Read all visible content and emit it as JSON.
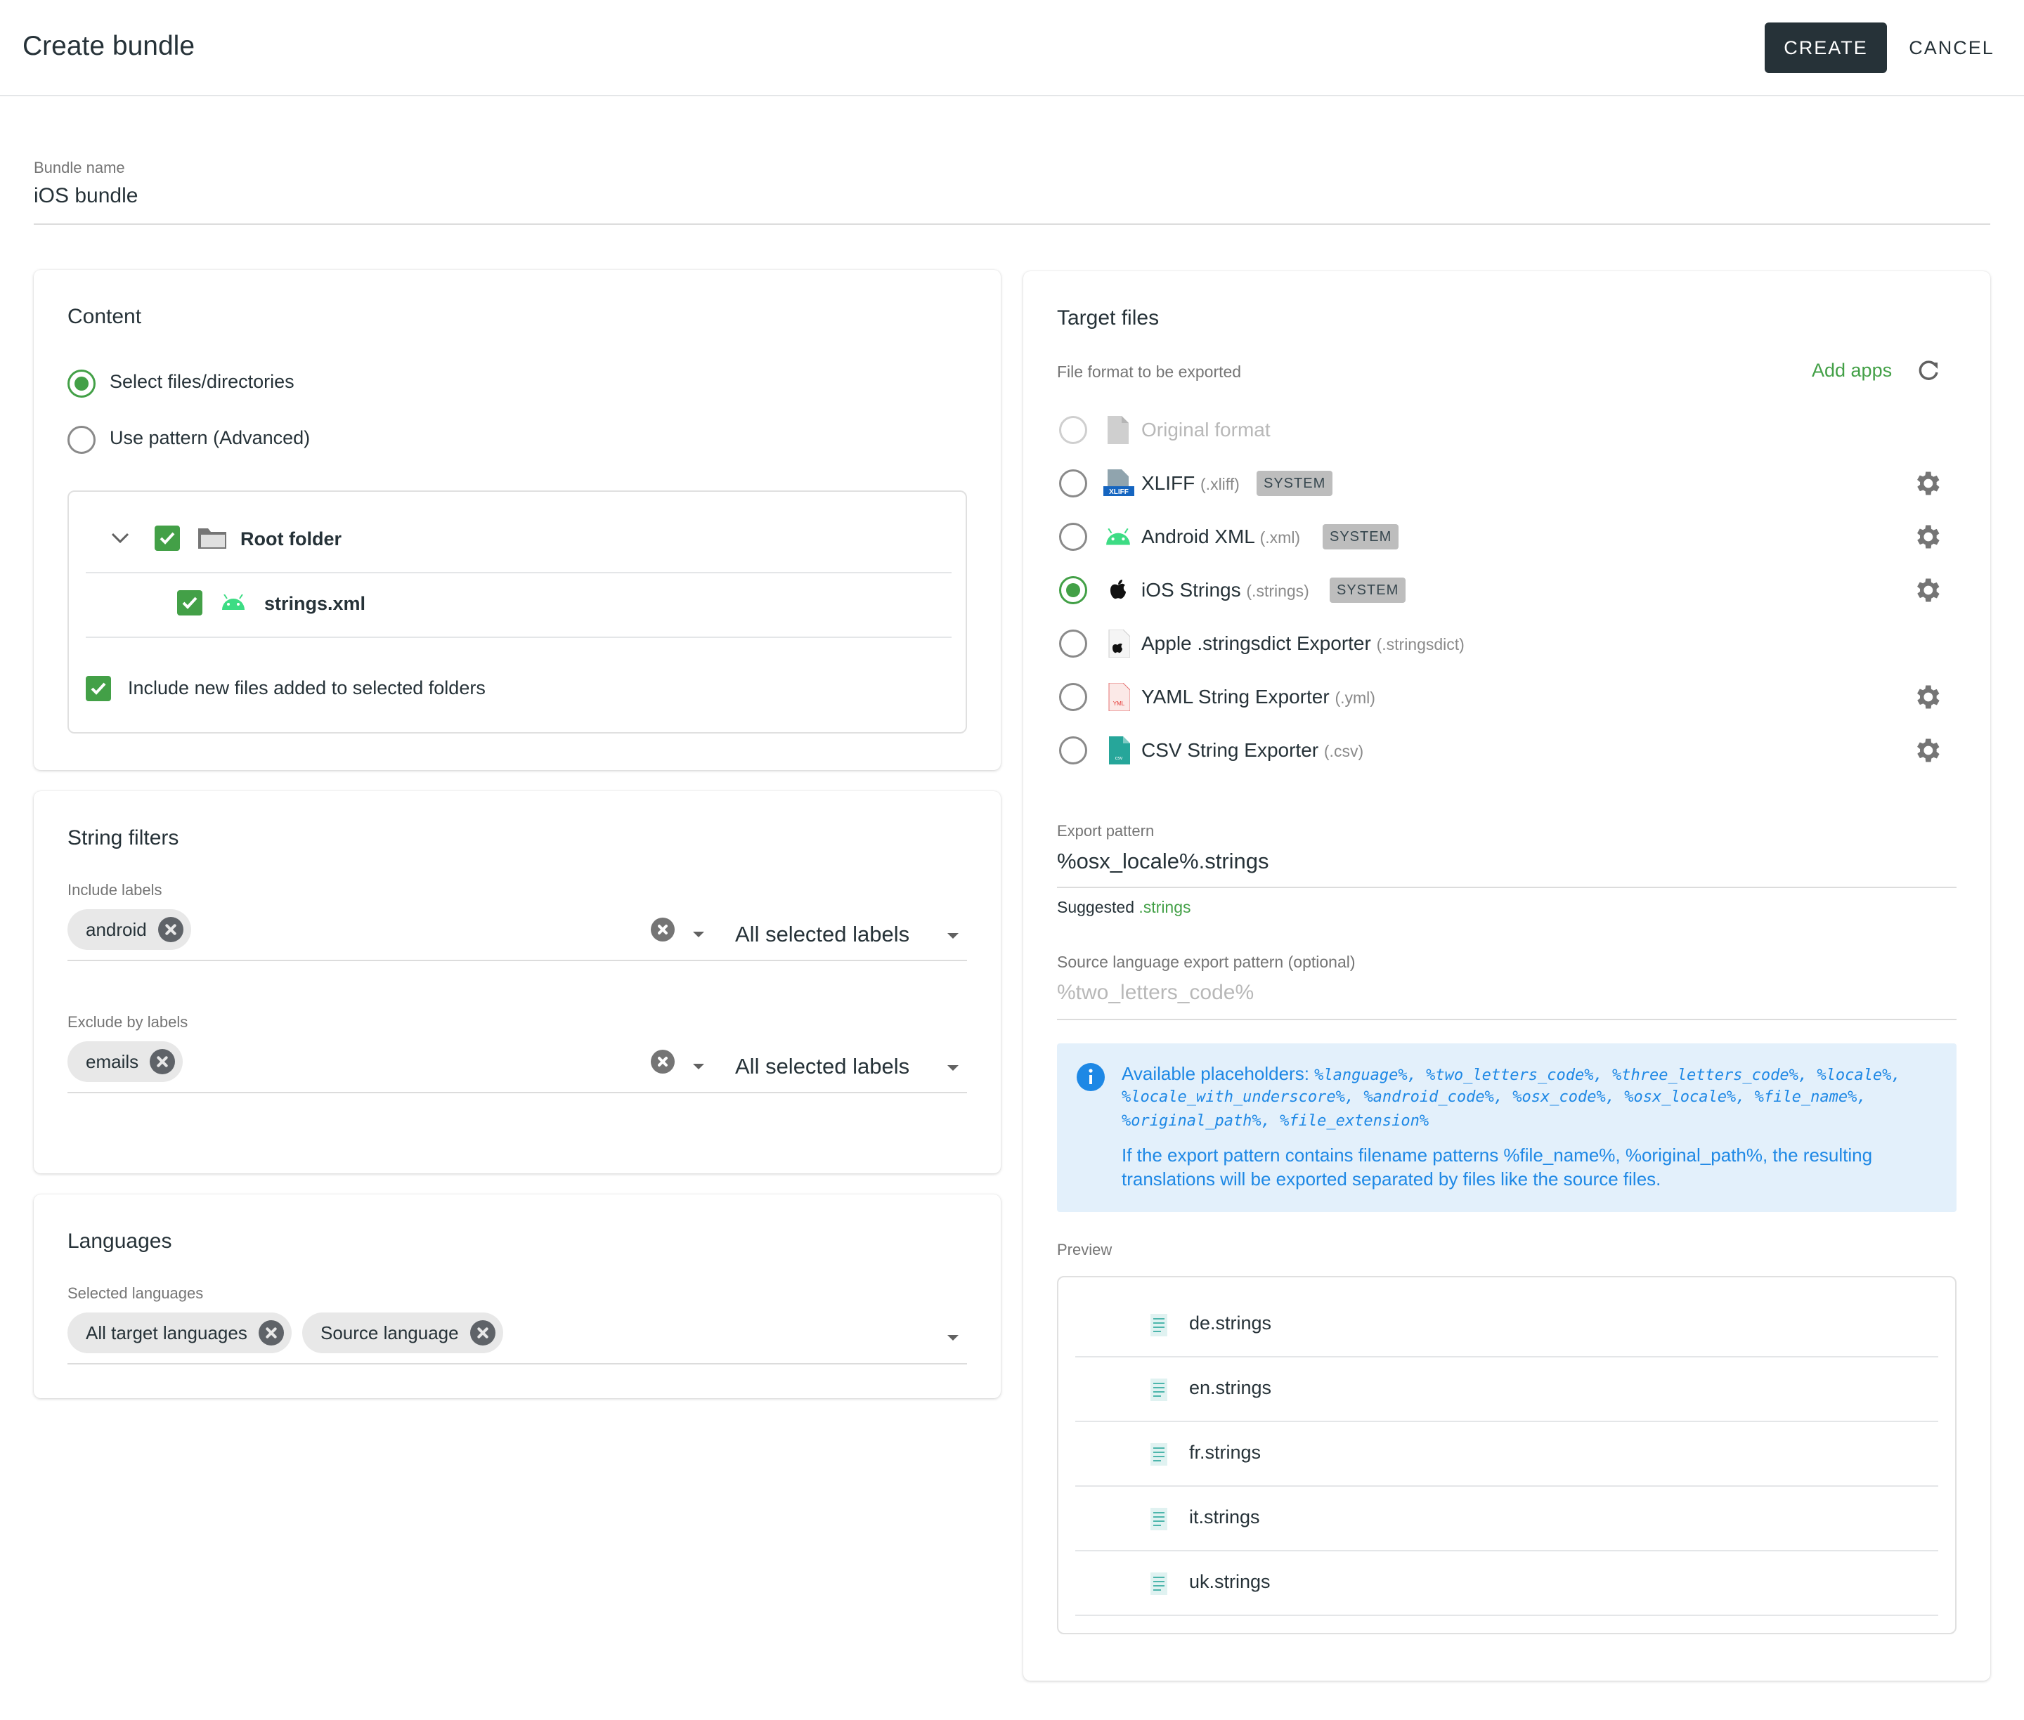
{
  "header": {
    "title": "Create bundle",
    "create_label": "CREATE",
    "cancel_label": "CANCEL"
  },
  "bundle_name": {
    "label": "Bundle name",
    "value": "iOS bundle"
  },
  "content": {
    "title": "Content",
    "options": [
      {
        "label": "Select files/directories",
        "selected": true
      },
      {
        "label": "Use pattern (Advanced)",
        "selected": false
      }
    ],
    "tree": {
      "root": "Root folder",
      "file": "strings.xml"
    },
    "include_new": "Include new files added to selected folders"
  },
  "string_filters": {
    "title": "String filters",
    "include": {
      "label": "Include labels",
      "chip": "android",
      "mode": "All selected labels"
    },
    "exclude": {
      "label": "Exclude by labels",
      "chip": "emails",
      "mode": "All selected labels"
    }
  },
  "languages": {
    "title": "Languages",
    "label": "Selected languages",
    "chips": [
      "All target languages",
      "Source language"
    ]
  },
  "target_files": {
    "title": "Target files",
    "format_label": "File format to be exported",
    "add_apps": "Add apps",
    "formats": [
      {
        "name": "Original format",
        "ext": "",
        "badge": "",
        "selected": false,
        "disabled": true,
        "icon": "file-icon"
      },
      {
        "name": "XLIFF",
        "ext": "(.xliff)",
        "badge": "SYSTEM",
        "selected": false,
        "icon": "xliff-icon"
      },
      {
        "name": "Android XML",
        "ext": "(.xml)",
        "badge": "SYSTEM",
        "selected": false,
        "icon": "android-icon"
      },
      {
        "name": "iOS Strings",
        "ext": "(.strings)",
        "badge": "SYSTEM",
        "selected": true,
        "icon": "apple-icon"
      },
      {
        "name": "Apple .stringsdict Exporter",
        "ext": "(.stringsdict)",
        "badge": "",
        "selected": false,
        "icon": "apple-file-icon"
      },
      {
        "name": "YAML String Exporter",
        "ext": "(.yml)",
        "badge": "",
        "selected": false,
        "icon": "yaml-icon"
      },
      {
        "name": "CSV String Exporter",
        "ext": "(.csv)",
        "badge": "",
        "selected": false,
        "icon": "csv-icon"
      }
    ],
    "export_pattern": {
      "label": "Export pattern",
      "value": "%osx_locale%.strings"
    },
    "suggested": {
      "prefix": "Suggested",
      "value": ".strings"
    },
    "source_pattern": {
      "label": "Source language export pattern (optional)",
      "placeholder": "%two_letters_code%"
    },
    "info": {
      "lead": "Available placeholders:",
      "line1": "%language%, %two_letters_code%, %three_letters_code%, %locale%,",
      "line2": "%locale_with_underscore%, %android_code%, %osx_code%, %osx_locale%, %file_name%,",
      "line3": "%original_path%, %file_extension%",
      "note1": "If the export pattern contains filename patterns %file_name%, %original_path%, the resulting",
      "note2": "translations will be exported separated by files like the source files."
    },
    "preview": {
      "label": "Preview",
      "files": [
        "de.strings",
        "en.strings",
        "fr.strings",
        "it.strings",
        "uk.strings"
      ]
    }
  },
  "colors": {
    "accent": "#43a047",
    "primary": "#263238",
    "info_text": "#1e88e5",
    "info_bg": "#e3f0fb"
  }
}
